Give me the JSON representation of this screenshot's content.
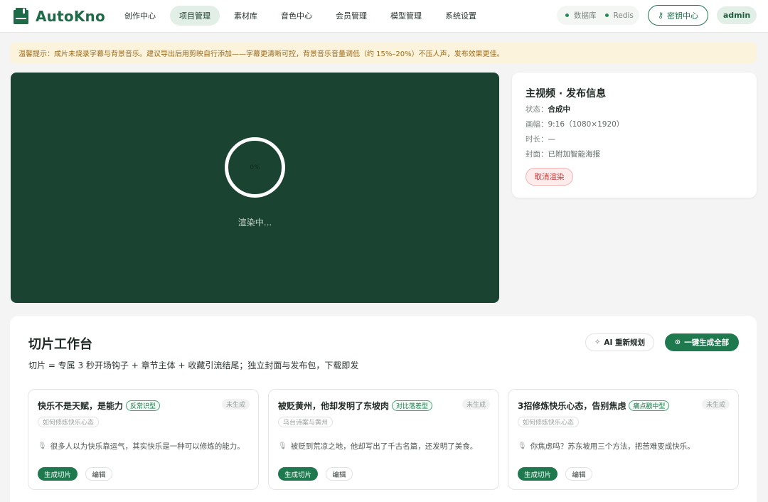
{
  "app": {
    "name": "AutoKno",
    "brand_color": "#1e6b48"
  },
  "nav": [
    {
      "label": "创作中心",
      "active": false
    },
    {
      "label": "项目管理",
      "active": true
    },
    {
      "label": "素材库",
      "active": false
    },
    {
      "label": "音色中心",
      "active": false
    },
    {
      "label": "会员管理",
      "active": false
    },
    {
      "label": "模型管理",
      "active": false
    },
    {
      "label": "系统设置",
      "active": false
    }
  ],
  "status": {
    "db_label": "数据库",
    "redis_label": "Redis",
    "status_color": "#1f8a55"
  },
  "header": {
    "key_center": "密钥中心",
    "user": "admin"
  },
  "notice": {
    "text": "温馨提示：成片未烧录字幕与背景音乐。建议导出后用剪映自行添加——字幕更清晰可控，背景音乐音量调低（约 15%–20%）不压人声，发布效果更佳。"
  },
  "render": {
    "progress_label": "0%",
    "progress": 0,
    "status_text": "渲染中..."
  },
  "publish": {
    "title": "主视频 · 发布信息",
    "status_label": "状态：",
    "status_value": "合成中",
    "ratio_label": "画幅：",
    "ratio_value": "9:16（1080×1920）",
    "duration_label": "时长：",
    "duration_value": "—",
    "cover_label": "封面：",
    "cover_value": "已附加智能海报",
    "cancel_label": "取消渲染"
  },
  "workbench": {
    "title": "切片工作台",
    "description": "切片 = 专属 3 秒开场钩子 + 章节主体 + 收藏引流结尾；独立封面与发布包，下载即发",
    "ai_button": "AI 重新规划",
    "generate_all": "一键生成全部",
    "cards": [
      {
        "title": "快乐不是天赋，是能力",
        "type_tag": "反常识型",
        "state": "未生成",
        "sub_tag": "如何修炼快乐心态",
        "quote": "很多人以为快乐靠运气，其实快乐是一种可以修炼的能力。",
        "generate_label": "生成切片",
        "edit_label": "编辑"
      },
      {
        "title": "被贬黄州，他却发明了东坡肉",
        "type_tag": "对比落差型",
        "state": "未生成",
        "sub_tag": "乌台诗案与黄州",
        "quote": "被贬到荒凉之地，他却写出了千古名篇，还发明了美食。",
        "generate_label": "生成切片",
        "edit_label": "编辑"
      },
      {
        "title": "3招修炼快乐心态，告别焦虑",
        "type_tag": "痛点戳中型",
        "state": "未生成",
        "sub_tag": "如何修炼快乐心态",
        "quote": "你焦虑吗？苏东坡用三个方法，把苦难变成快乐。",
        "generate_label": "生成切片",
        "edit_label": "编辑"
      }
    ]
  }
}
